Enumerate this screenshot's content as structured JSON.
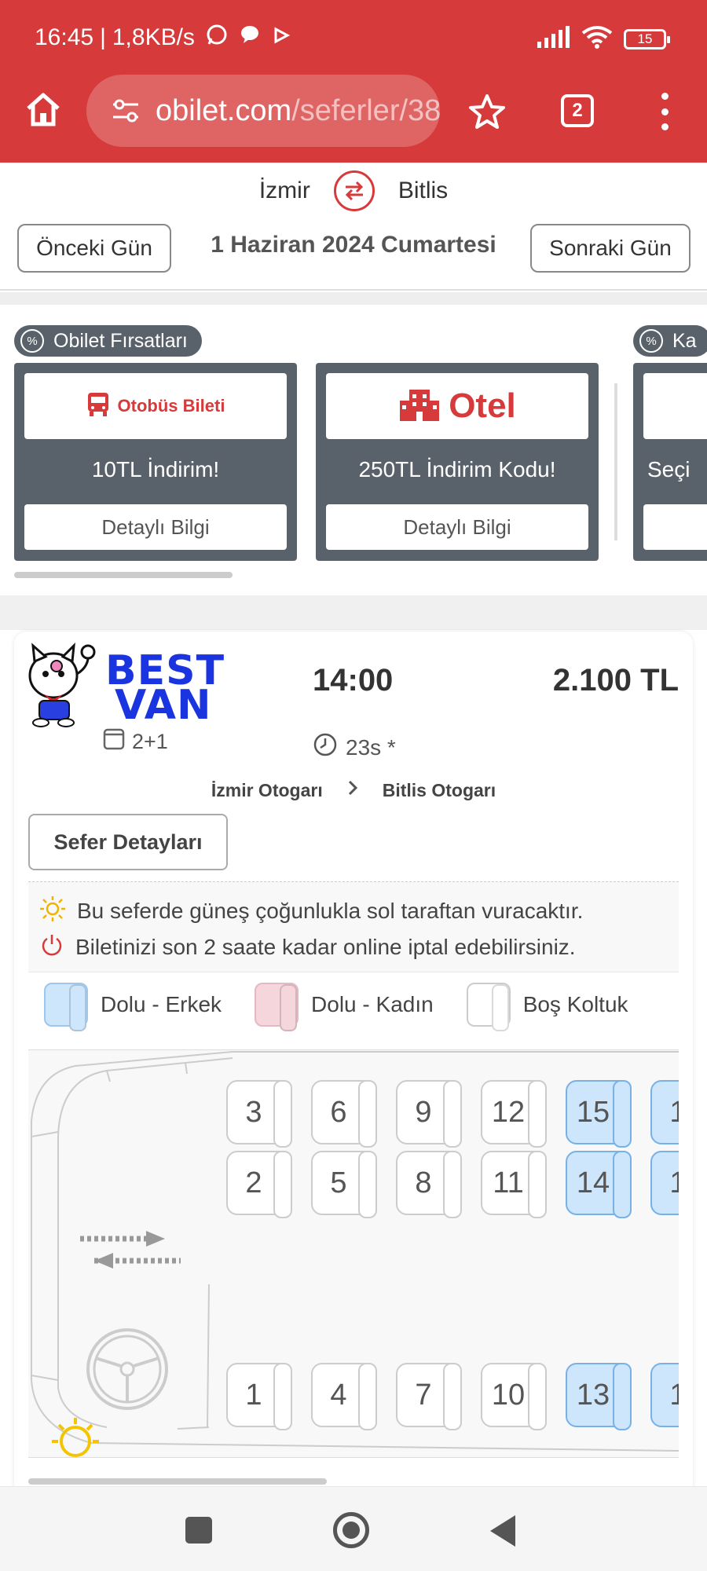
{
  "status": {
    "time": "16:45",
    "speed": "1,8KB/s",
    "battery": "15"
  },
  "browser": {
    "url_host": "obilet.com",
    "url_path": "/seferler/38",
    "tab_count": "2"
  },
  "route": {
    "from": "İzmir",
    "to": "Bitlis",
    "prev_day": "Önceki Gün",
    "next_day": "Sonraki Gün",
    "date": "1 Haziran 2024 Cumartesi"
  },
  "deals": {
    "tag1": "Obilet Fırsatları",
    "tag2": "Ka",
    "cards": [
      {
        "logo": "Otobüs Bileti",
        "text": "10TL İndirim!",
        "button": "Detaylı Bilgi"
      },
      {
        "logo": "Otel",
        "text": "250TL İndirim Kodu!",
        "button": "Detaylı Bilgi"
      },
      {
        "text": "Seçi"
      }
    ]
  },
  "trip": {
    "brand_line1": "BEST",
    "brand_line2": "VAN",
    "layout": "2+1",
    "departure": "14:00",
    "price": "2.100 TL",
    "duration": "23s *",
    "from_station": "İzmir Otogarı",
    "to_station": "Bitlis Otogarı",
    "details_button": "Sefer Detayları",
    "sun_info": "Bu seferde güneş çoğunlukla sol taraftan vuracaktır.",
    "cancel_info": "Biletinizi son 2 saate kadar online iptal edebilirsiniz.",
    "legend": {
      "male": "Dolu - Erkek",
      "female": "Dolu - Kadın",
      "empty": "Boş Koltuk"
    },
    "seats": {
      "row_top": [
        "3",
        "6",
        "9",
        "12",
        "15",
        "1"
      ],
      "row_mid": [
        "2",
        "5",
        "8",
        "11",
        "14",
        "1"
      ],
      "row_bottom": [
        "1",
        "4",
        "7",
        "10",
        "13",
        "1"
      ],
      "occupied_male": [
        "15",
        "14",
        "13"
      ]
    }
  },
  "colors": {
    "brand_red": "#d63a3a",
    "deal_gray": "#59626a",
    "male_seat": "#cde6fb",
    "female_seat": "#f4d6dc",
    "brand_blue": "#1a34e0"
  }
}
